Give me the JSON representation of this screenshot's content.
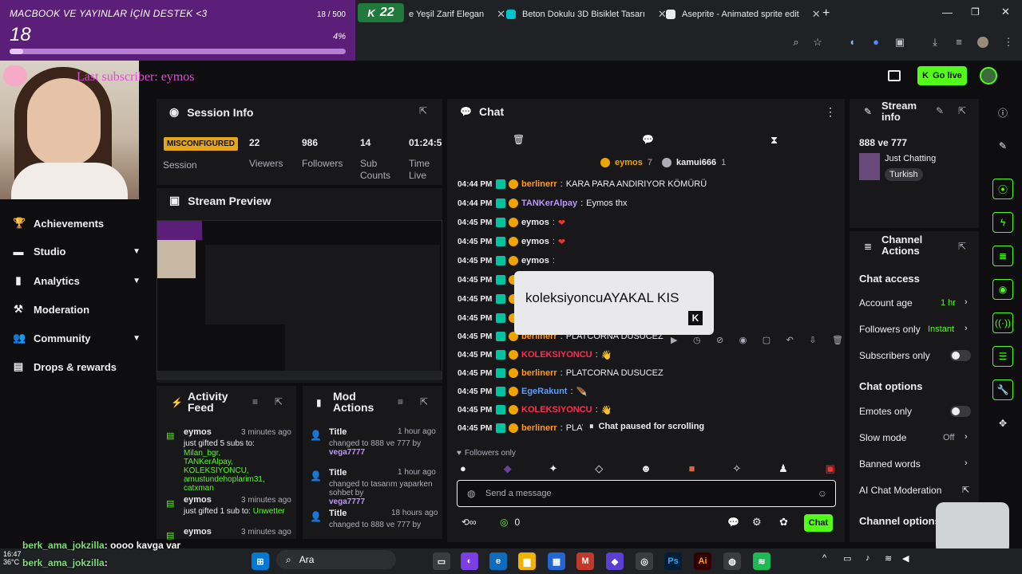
{
  "overlay": {
    "goal_title": "MACBOOK VE YAYINLAR İÇİN DESTEK <3",
    "goal_current": "18",
    "goal_count": "18 / 500",
    "goal_percent": "4%",
    "goal_progress": 0.04,
    "last_subscriber": "Last subscriber: eymos"
  },
  "browser": {
    "timer": "22",
    "tabs": [
      {
        "label": "e Yeşil Zarif Elegan",
        "color": "#f0a400"
      },
      {
        "label": "Beton Dokulu 3D Bisiklet Tasarı",
        "color": "#00c4cc"
      },
      {
        "label": "Aseprite - Animated sprite edit",
        "color": "#e8eaed"
      }
    ]
  },
  "topbar": {
    "go_live": "Go live"
  },
  "sidebar": {
    "items": [
      {
        "label": "Achievements",
        "icon": "trophy-icon",
        "chevron": false
      },
      {
        "label": "Studio",
        "icon": "studio-icon",
        "chevron": true
      },
      {
        "label": "Analytics",
        "icon": "chart-icon",
        "chevron": true
      },
      {
        "label": "Moderation",
        "icon": "hammer-icon",
        "chevron": false
      },
      {
        "label": "Community",
        "icon": "people-icon",
        "chevron": true
      },
      {
        "label": "Drops & rewards",
        "icon": "gift-icon",
        "chevron": false
      }
    ]
  },
  "session": {
    "title": "Session Info",
    "status": "MISCONFIGURED",
    "status_label": "Session",
    "stats": [
      {
        "value": "22",
        "label": "Viewers"
      },
      {
        "value": "986",
        "label": "Followers"
      },
      {
        "value": "14",
        "label": "Sub Counts"
      },
      {
        "value": "01:24:5",
        "label": "Time Live"
      }
    ]
  },
  "preview": {
    "title": "Stream Preview"
  },
  "activity": {
    "title": "Activity Feed",
    "items": [
      {
        "user": "eymos",
        "time": "3 minutes ago",
        "line1": "just gifted 5 subs to:",
        "names": "Milan_bgr, TANKerAlpay, KOLEKSIYONCU, amustundehoplarim31, catxman"
      },
      {
        "user": "eymos",
        "time": "3 minutes ago",
        "line1": "just gifted 1 sub to:",
        "names": "Unwetter"
      },
      {
        "user": "eymos",
        "time": "3 minutes ago",
        "line1": "",
        "names": ""
      }
    ]
  },
  "mod_actions": {
    "title": "Mod Actions",
    "items": [
      {
        "title": "Title",
        "time": "1 hour ago",
        "line": "changed to 888 ve 777 by",
        "by": "vega7777"
      },
      {
        "title": "Title",
        "time": "1 hour ago",
        "line": "changed to tasarım yaparken sohbet by",
        "by": "vega7777"
      },
      {
        "title": "Title",
        "time": "18 hours ago",
        "line": "changed to 888 ve 777 by",
        "by": "vega7777"
      }
    ]
  },
  "chat": {
    "title": "Chat",
    "pinned": [
      {
        "user": "eymos",
        "count": "7"
      },
      {
        "user": "kamui666",
        "count": "1"
      }
    ],
    "messages": [
      {
        "time": "04:44 PM",
        "user": "berlinerr",
        "text": "KARA PARA ANDIRIYOR KÖMÜRÜ",
        "color": "#ff9a1f"
      },
      {
        "time": "04:44 PM",
        "user": "TANKerAlpay",
        "text": "Eymos thx",
        "color": "#bf94ff"
      },
      {
        "time": "04:45 PM",
        "user": "eymos",
        "text": "❤",
        "color": "#efeff1"
      },
      {
        "time": "04:45 PM",
        "user": "eymos",
        "text": "❤",
        "color": "#efeff1"
      },
      {
        "time": "04:45 PM",
        "user": "eymos",
        "text": "",
        "color": "#efeff1"
      },
      {
        "time": "04:45 PM",
        "user": "",
        "text": "",
        "color": "#ff4d6d"
      },
      {
        "time": "04:45 PM",
        "user": "",
        "text": "",
        "color": "#ff4d6d"
      },
      {
        "time": "04:45 PM",
        "user": "",
        "text": "",
        "color": "#ff4d6d"
      },
      {
        "time": "04:45 PM",
        "user": "berlinerr",
        "text": "PLATCORNA DUSUCEZ",
        "color": "#ff9a1f"
      },
      {
        "time": "04:45 PM",
        "user": "KOLEKSIYONCU",
        "text": "👋",
        "color": "#ff2e4d"
      },
      {
        "time": "04:45 PM",
        "user": "berlinerr",
        "text": "PLATCORNA DUSUCEZ",
        "color": "#ff9a1f"
      },
      {
        "time": "04:45 PM",
        "user": "EgeRakunt",
        "text": "🪶",
        "color": "#5b9cff"
      },
      {
        "time": "04:45 PM",
        "user": "KOLEKSIYONCU",
        "text": "👋",
        "color": "#ff2e4d"
      },
      {
        "time": "04:45 PM",
        "user": "berlinerr",
        "text": "PLATCOI",
        "color": "#ff9a1f"
      }
    ],
    "tooltip": "koleksiyoncuAYAKAL KIS",
    "paused": "Chat paused for scrolling",
    "followers_only": "Followers only",
    "input_placeholder": "Send a message",
    "points": "0",
    "send": "Chat"
  },
  "stream_info": {
    "title": "Stream info",
    "stream_title": "888 ve 777",
    "category": "Just Chatting",
    "tag": "Turkish"
  },
  "channel_actions": {
    "title": "Channel Actions",
    "chat_access": "Chat access",
    "account_age": {
      "label": "Account age",
      "value": "1 hr"
    },
    "followers_only": {
      "label": "Followers only",
      "value": "Instant"
    },
    "subscribers_only": {
      "label": "Subscribers only"
    },
    "chat_options": "Chat options",
    "emotes_only": {
      "label": "Emotes only"
    },
    "slow_mode": {
      "label": "Slow mode",
      "value": "Off"
    },
    "banned_words": {
      "label": "Banned words"
    },
    "ai_moderation": {
      "label": "AI Chat Moderation"
    },
    "channel_options": "Channel options"
  },
  "stream_chat_overlay": [
    {
      "user": "berk_ama_jokzilla",
      "text": ": oooo kavga var"
    },
    {
      "user": "berk_ama_jokzilla",
      "text": ":"
    }
  ],
  "taskbar": {
    "time": "16:47",
    "weather": "36°C",
    "search": "Ara"
  }
}
